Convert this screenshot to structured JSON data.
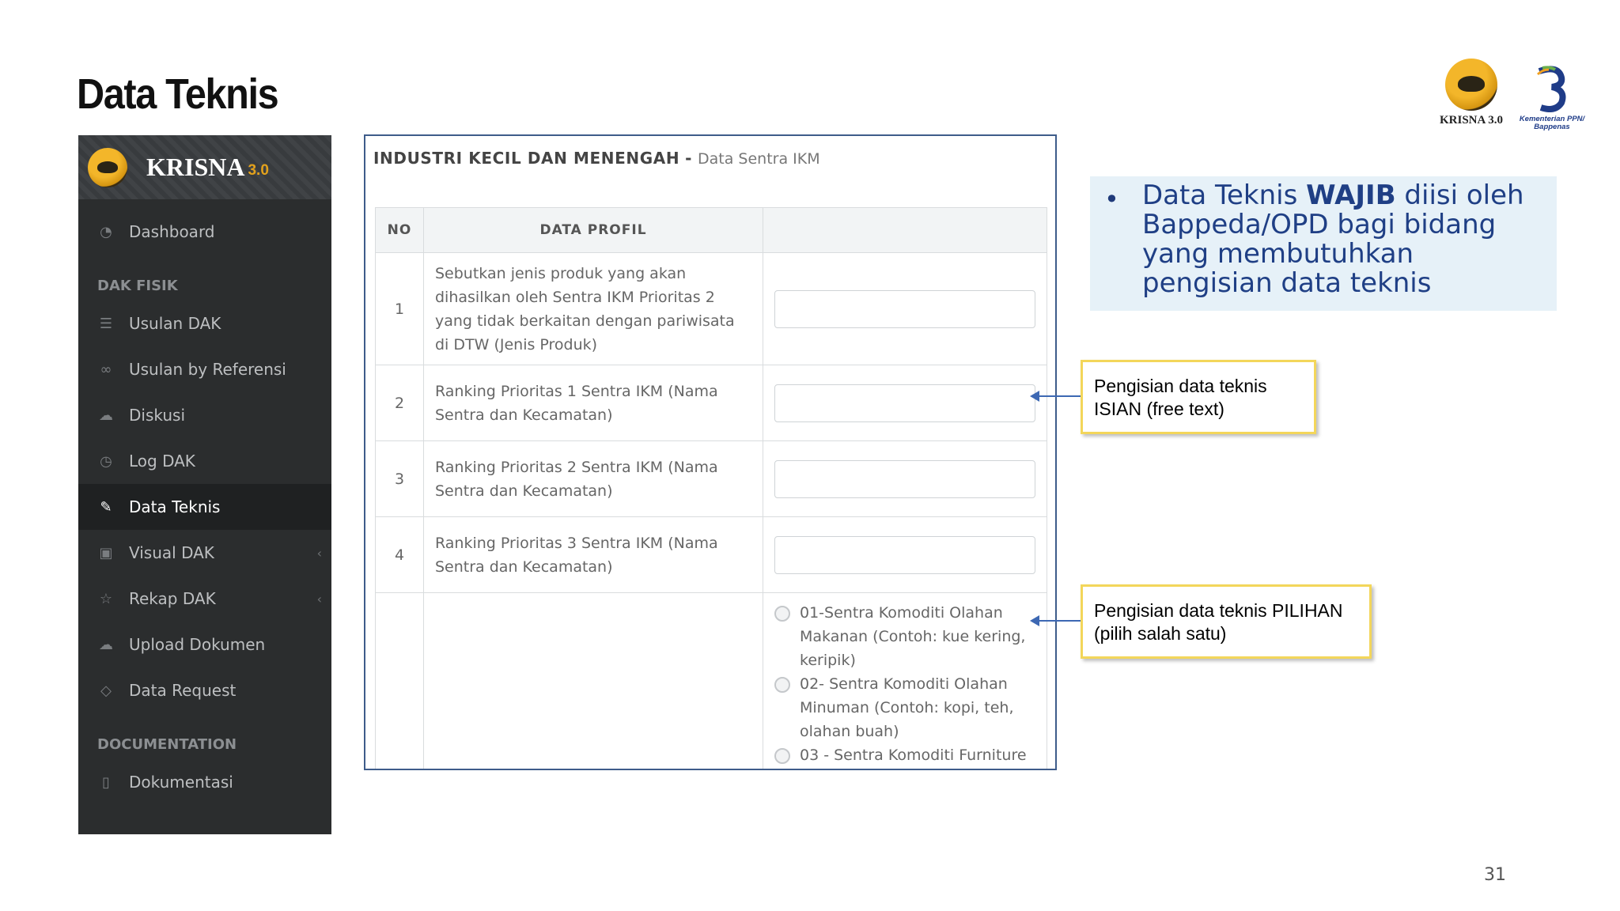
{
  "slide": {
    "title": "Data Teknis",
    "page_number": "31"
  },
  "logos": {
    "krisna_caption": "KRISNA 3.0",
    "ppn_caption_line1": "Kementerian PPN/",
    "ppn_caption_line2": "Bappenas"
  },
  "sidebar": {
    "brand": {
      "name": "KRISNA",
      "version": "3.0"
    },
    "items": [
      {
        "label": "Dashboard",
        "icon": "dashboard-icon"
      },
      {
        "section": "DAK FISIK"
      },
      {
        "label": "Usulan DAK",
        "icon": "list-icon"
      },
      {
        "label": "Usulan by Referensi",
        "icon": "link-icon"
      },
      {
        "label": "Diskusi",
        "icon": "chat-icon"
      },
      {
        "label": "Log DAK",
        "icon": "clock-icon"
      },
      {
        "label": "Data Teknis",
        "icon": "paperclip-icon",
        "active": true
      },
      {
        "label": "Visual DAK",
        "icon": "image-icon",
        "chevron": "chevron-left-icon"
      },
      {
        "label": "Rekap DAK",
        "icon": "star-icon",
        "chevron": "chevron-left-icon"
      },
      {
        "label": "Upload Dokumen",
        "icon": "cloud-upload-icon"
      },
      {
        "label": "Data Request",
        "icon": "tag-icon"
      },
      {
        "section": "DOCUMENTATION"
      },
      {
        "label": "Dokumentasi",
        "icon": "book-icon"
      }
    ]
  },
  "form": {
    "title": "INDUSTRI KECIL DAN MENENGAH",
    "separator": "-",
    "subtitle": "Data Sentra IKM",
    "columns": [
      "NO",
      "DATA PROFIL",
      ""
    ],
    "rows": [
      {
        "no": "1",
        "question": "Sebutkan jenis produk yang akan dihasilkan oleh Sentra IKM Prioritas 2 yang tidak berkaitan dengan pariwisata di DTW (Jenis Produk)",
        "value": ""
      },
      {
        "no": "2",
        "question": "Ranking Prioritas 1 Sentra IKM (Nama Sentra dan Kecamatan)",
        "value": ""
      },
      {
        "no": "3",
        "question": "Ranking Prioritas 2 Sentra IKM (Nama Sentra dan Kecamatan)",
        "value": ""
      },
      {
        "no": "4",
        "question": "Ranking Prioritas 3 Sentra IKM (Nama Sentra dan Kecamatan)",
        "value": ""
      }
    ],
    "radio_options": [
      "01-Sentra Komoditi Olahan Makanan (Contoh: kue kering, keripik)",
      "02- Sentra Komoditi Olahan Minuman (Contoh: kopi, teh, olahan buah)",
      "03 - Sentra Komoditi Furniture"
    ]
  },
  "info": {
    "part1": "Data Teknis ",
    "emphasis": "WAJIB",
    "part2": " diisi oleh Bappeda/OPD bagi bidang yang membutuhkan pengisian data teknis"
  },
  "callouts": {
    "isian": "Pengisian data teknis ISIAN (free text)",
    "pilihan": "Pengisian data teknis PILIHAN (pilih salah satu)"
  },
  "colors": {
    "sidebar_bg": "#2b2d2e",
    "accent_gold": "#e2a11c",
    "info_text": "#1f3f85",
    "callout_border": "#f3d65a",
    "arrow": "#3d68b3"
  }
}
